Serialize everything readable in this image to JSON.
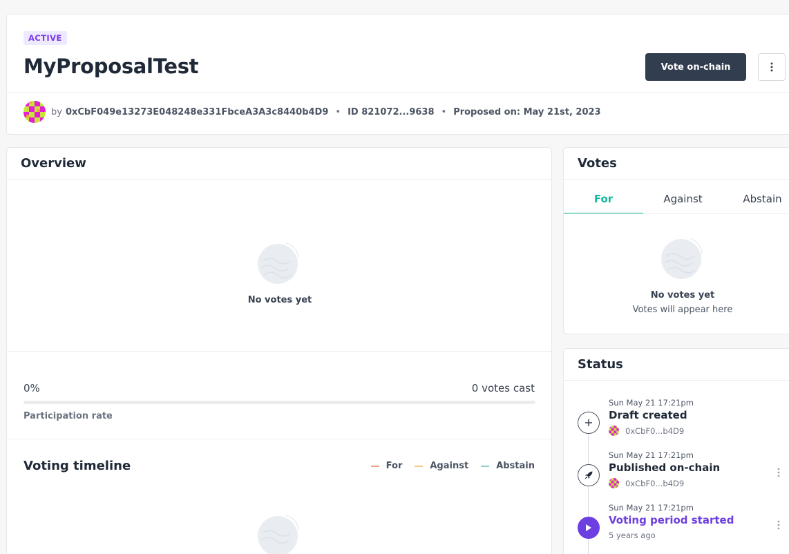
{
  "proposal": {
    "status_badge": "ACTIVE",
    "title": "MyProposalTest",
    "vote_button": "Vote on-chain",
    "by_prefix": "by",
    "author_address": "0xCbF049e13273E048248e331FbceA3A3c8440b4D9",
    "id_text": "ID 821072...9638",
    "proposed_on": "Proposed on: May 21st, 2023",
    "more_icon": "vertical-ellipsis-icon",
    "avatar_icon": "identicon-avatar"
  },
  "overview": {
    "title": "Overview",
    "empty_text": "No votes yet",
    "participation_percent": "0%",
    "participation_fraction": 0,
    "votes_cast": "0 votes cast",
    "participation_label": "Participation rate",
    "timeline_title": "Voting timeline",
    "legend": [
      {
        "label": "For",
        "color": "#f0a37d"
      },
      {
        "label": "Against",
        "color": "#f3c98a"
      },
      {
        "label": "Abstain",
        "color": "#8ad0c6"
      }
    ]
  },
  "votes": {
    "title": "Votes",
    "tabs": [
      {
        "label": "For",
        "active": true
      },
      {
        "label": "Against",
        "active": false
      },
      {
        "label": "Abstain",
        "active": false
      }
    ],
    "empty_title": "No votes yet",
    "empty_sub": "Votes will appear here"
  },
  "status": {
    "title": "Status",
    "items": [
      {
        "time": "Sun May 21 17:21pm",
        "label": "Draft created",
        "sub": "0xCbF0...b4D9",
        "icon": "plus-icon"
      },
      {
        "time": "Sun May 21 17:21pm",
        "label": "Published on-chain",
        "sub": "0xCbF0...b4D9",
        "icon": "rocket-icon"
      },
      {
        "time": "Sun May 21 17:21pm",
        "label": "Voting period started",
        "sub": "5 years ago",
        "icon": "play-icon"
      }
    ]
  },
  "colors": {
    "accent_purple": "#6d3fe0",
    "tab_active": "#14b89a",
    "button_dark": "#323d4f"
  }
}
